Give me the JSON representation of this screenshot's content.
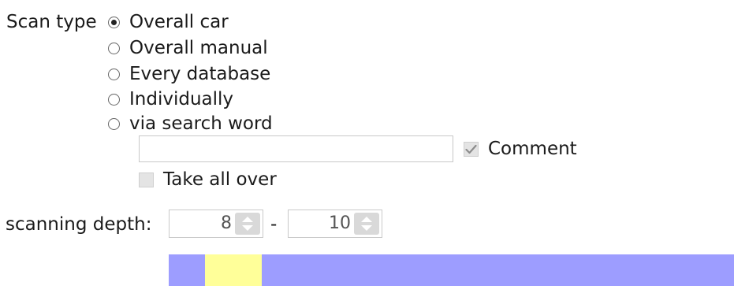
{
  "scan_type": {
    "label": "Scan type",
    "selected": "Overall car",
    "options": [
      {
        "label": "Overall car",
        "checked": true
      },
      {
        "label": "Overall manual",
        "checked": false
      },
      {
        "label": "Every database",
        "checked": false
      },
      {
        "label": "Individually",
        "checked": false
      },
      {
        "label": "via search word",
        "checked": false
      }
    ]
  },
  "search_word": {
    "value": "",
    "placeholder": ""
  },
  "comment": {
    "label": "Comment",
    "checked": true
  },
  "take_all_over": {
    "label": "Take all over",
    "checked": false
  },
  "scanning_depth": {
    "label": "scanning depth:",
    "from_value": "8",
    "separator": "-",
    "to_value": "10"
  },
  "colors": {
    "range_bar": "#9d9dff",
    "range_highlight": "#ffff99"
  }
}
